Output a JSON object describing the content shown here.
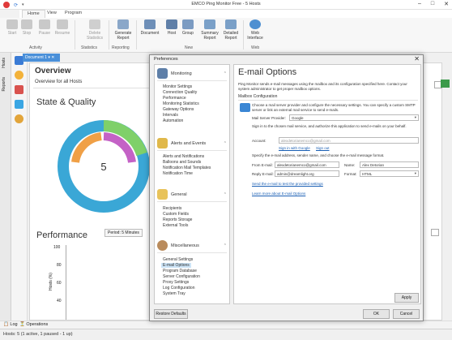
{
  "app": {
    "title": "EMCO Ping Monitor Free - 5 Hosts"
  },
  "ribbon": {
    "tabs": [
      {
        "label": "Home"
      },
      {
        "label": "View"
      },
      {
        "label": "Program"
      }
    ],
    "activity": {
      "label": "Activity",
      "start": "Start",
      "stop": "Stop",
      "pause": "Pause",
      "resume": "Resume"
    },
    "statistics": {
      "label": "Statistics",
      "delete": "Delete Statistics"
    },
    "reporting": {
      "label": "Reporting",
      "generate": "Generate Report"
    },
    "new": {
      "label": "New",
      "document": "Document",
      "host": "Host",
      "group": "Group",
      "summary": "Summary Report",
      "detailed": "Detailed Report"
    },
    "web": {
      "label": "Web",
      "interface": "Web Interface"
    }
  },
  "side": {
    "hosts": "Hosts",
    "reports": "Reports"
  },
  "document_tab": "Document 1",
  "overview": {
    "title": "Overview",
    "subtitle": "Overview for all Hosts",
    "state_title": "State & Quality",
    "center_value": "5",
    "perf_title": "Performance",
    "period": "Period: 5 Minutes",
    "perf_ticks": [
      "100",
      "80",
      "60",
      "40"
    ],
    "perf_ylabel": "Hosts (%)"
  },
  "bottom": {
    "log": "Log",
    "operations": "Operations"
  },
  "status": {
    "text": "Hosts: 5 (1 active, 1 paused - 1 up)"
  },
  "dialog": {
    "title": "Preferences",
    "close": "✕",
    "nav": {
      "monitoring": {
        "label": "Monitoring",
        "items": [
          "Monitor Settings",
          "Connection Quality",
          "Performance",
          "Monitoring Statistics",
          "Gateway Options",
          "Intervals",
          "Automation"
        ]
      },
      "alerts": {
        "label": "Alerts and Events",
        "items": [
          "Alerts and Notifications",
          "Balloons and Sounds",
          "Notification Mail Templates",
          "Notification Time"
        ]
      },
      "general": {
        "label": "General",
        "items": [
          "Recipients",
          "Custom Fields",
          "Reports Storage",
          "External Tools"
        ]
      },
      "misc": {
        "label": "Miscellaneous",
        "items": [
          "General Settings",
          "E-mail Options",
          "Program Database",
          "Server Configuration",
          "Proxy Settings",
          "Log Configuration",
          "System Tray"
        ]
      }
    },
    "content": {
      "title": "E-mail Options",
      "intro": "Ping Monitor sends e-mail messages using the mailbox and its configuration specified here. Contact your system administrator to get proper mailbox options.",
      "section": "Mailbox Configuration",
      "provider_desc": "Choose a mail server provider and configure the necessary settings. You can specify a custom SMTP server or link an external mail service to send e-mails.",
      "provider_label": "Mail Server Provider:",
      "provider_value": "Google",
      "signin_desc": "Sign in to the chosen mail service, and authorize this application to send e-mails on your behalf.",
      "account_label": "Account:",
      "account_value": "alexdetorianemco@gmail.com",
      "signin_link": "Sign in with Google",
      "signout_link": "Sign out",
      "sender_desc": "Specify the e-mail address, sender name, and choose the e-mail message format.",
      "from_label": "From E-mail:",
      "from_value": "alexdetorianemco@gmail.com",
      "name_label": "Name:",
      "name_value": "Alex Detorian",
      "reply_label": "Reply E-mail:",
      "reply_value": "admin@dreamlight.org",
      "format_label": "Format:",
      "format_value": "HTML",
      "test_link": "Send the e-mail to test the provided settings",
      "learn_link": "Learn more about E-mail Options",
      "apply": "Apply"
    },
    "restore": "Restore Defaults",
    "ok": "OK",
    "cancel": "Cancel"
  }
}
